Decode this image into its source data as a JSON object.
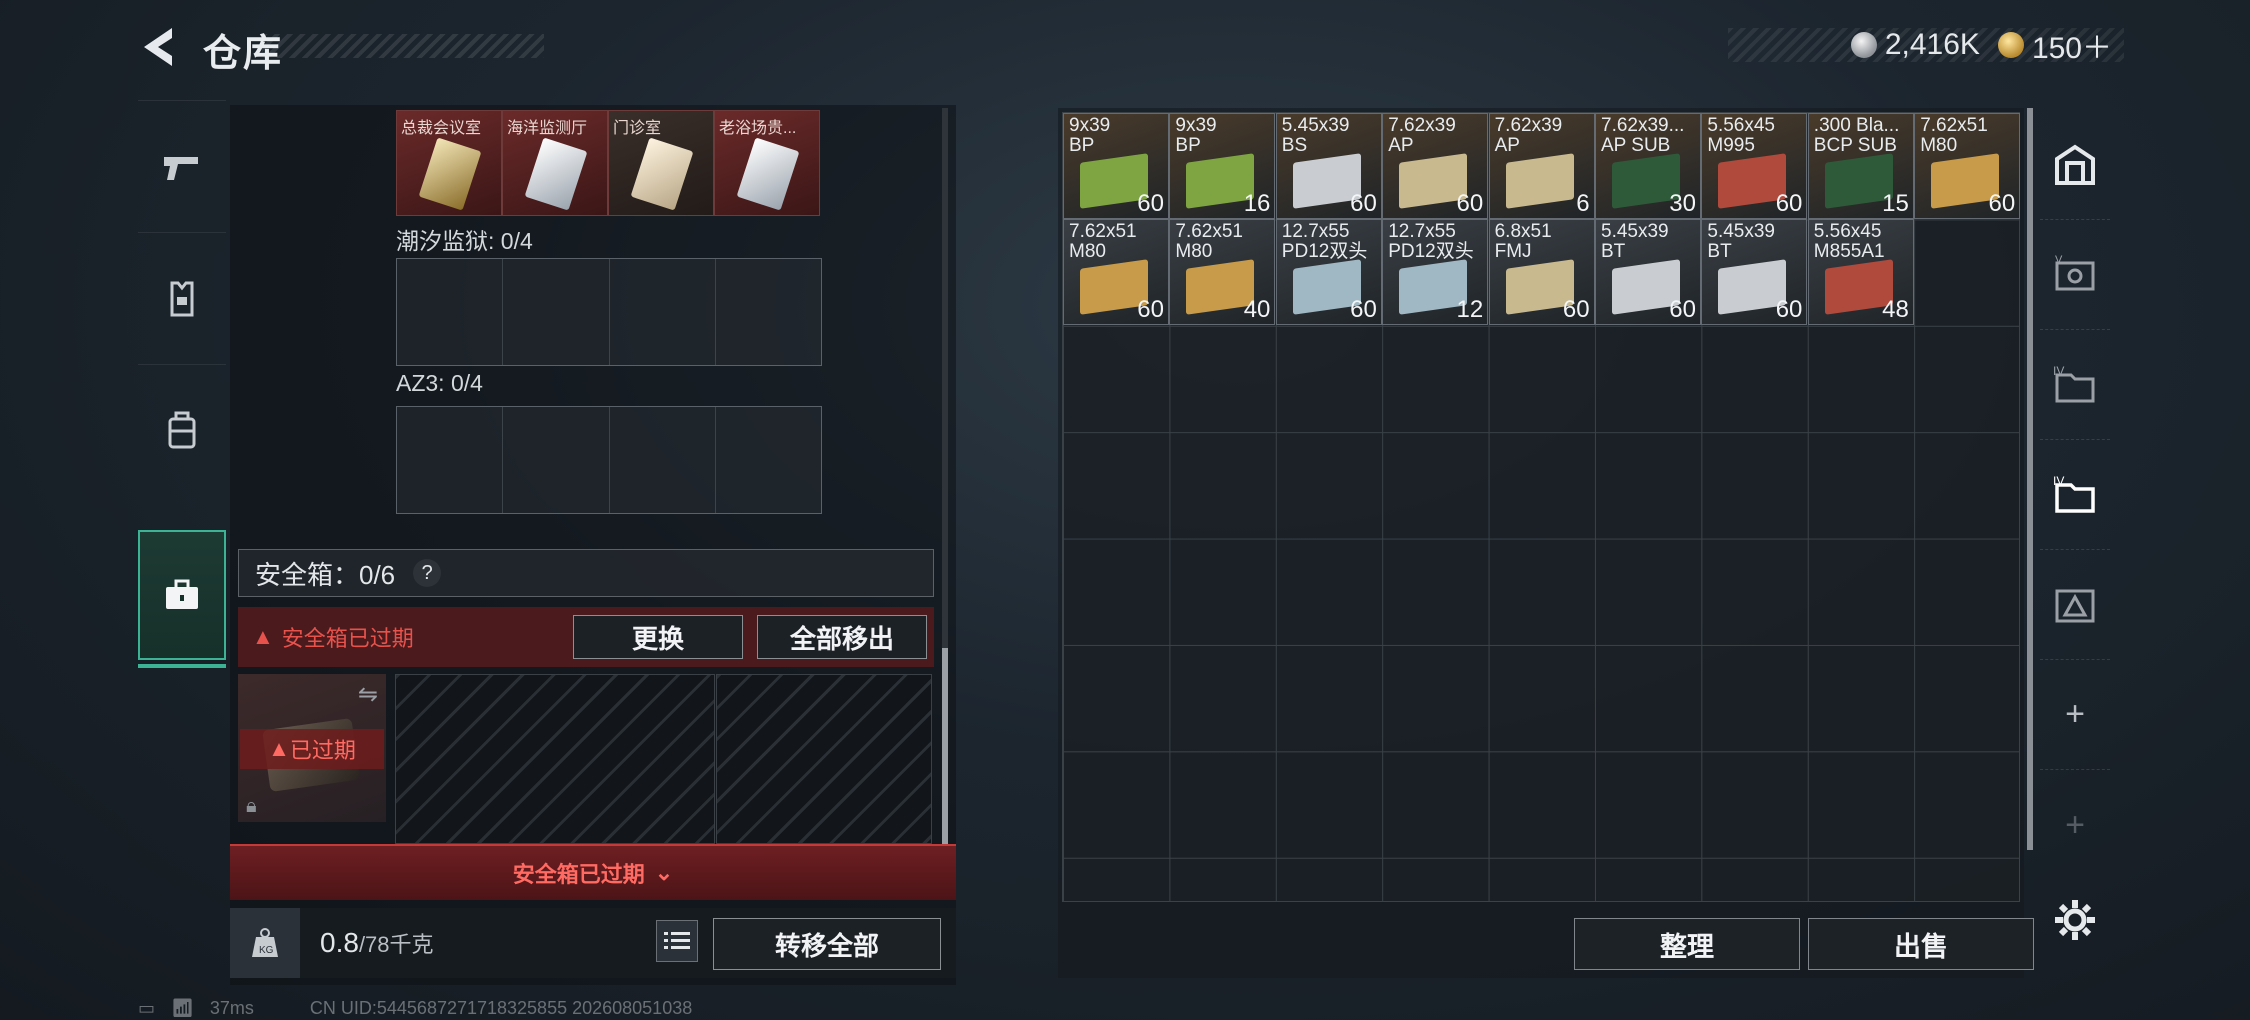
{
  "header": {
    "title": "仓库"
  },
  "currency": {
    "silver": "2,416K",
    "gold": "150＋"
  },
  "docs": [
    {
      "label": "总裁会议室",
      "style": "red",
      "card": "goldc"
    },
    {
      "label": "海洋监测厅",
      "style": "red",
      "card": "whitec"
    },
    {
      "label": "门诊室",
      "style": "dark",
      "card": "creamc"
    },
    {
      "label": "老浴场贵...",
      "style": "red",
      "card": "whitec"
    }
  ],
  "sections": {
    "tide_prison": "潮汐监狱: 0/4",
    "az3": "AZ3: 0/4"
  },
  "safe_box": {
    "label": "安全箱：0/6",
    "help": "?",
    "expired_warning": "安全箱已过期",
    "replace_button": "更换",
    "remove_all_button": "全部移出",
    "expired_tag": "已过期",
    "footer_text": "安全箱已过期"
  },
  "weight": {
    "value": "0.8",
    "max": "/78千克"
  },
  "transfer_all_button": "转移全部",
  "ammo": [
    {
      "cal": "9x39\nBP",
      "count": "60",
      "color": "#7fa542"
    },
    {
      "cal": "9x39\nBP",
      "count": "16",
      "color": "#7fa542"
    },
    {
      "cal": "5.45x39\nBS",
      "count": "60",
      "color": "#c9cdd1"
    },
    {
      "cal": "7.62x39\nAP",
      "count": "60",
      "color": "#c9b98f"
    },
    {
      "cal": "7.62x39\nAP",
      "count": "6",
      "color": "#c9b98f"
    },
    {
      "cal": "7.62x39...\nAP SUB",
      "count": "30",
      "color": "#2f5a3a"
    },
    {
      "cal": "5.56x45\nM995",
      "count": "60",
      "color": "#b04a3c"
    },
    {
      "cal": ".300 Bla...\nBCP SUB",
      "count": "15",
      "color": "#2f5a3a"
    },
    {
      "cal": "7.62x51\nM80",
      "count": "60",
      "color": "#c79b4a"
    },
    {
      "cal": "7.62x51\nM80",
      "count": "60",
      "color": "#c79b4a"
    },
    {
      "cal": "7.62x51\nM80",
      "count": "40",
      "color": "#c79b4a"
    },
    {
      "cal": "12.7x55\nPD12双头",
      "count": "60",
      "color": "#9fb8c3"
    },
    {
      "cal": "12.7x55\nPD12双头",
      "count": "12",
      "color": "#9fb8c3"
    },
    {
      "cal": "6.8x51\nFMJ",
      "count": "60",
      "color": "#c9b98f"
    },
    {
      "cal": "5.45x39\nBT",
      "count": "60",
      "color": "#c9cdd1"
    },
    {
      "cal": "5.45x39\nBT",
      "count": "60",
      "color": "#c9cdd1"
    },
    {
      "cal": "5.56x45\nM855A1",
      "count": "48",
      "color": "#b04a3c"
    }
  ],
  "right_buttons": {
    "sort": "整理",
    "sell": "出售"
  },
  "status": {
    "ping": "37ms",
    "uid": "CN UID:5445687271718325855 202608051038"
  }
}
